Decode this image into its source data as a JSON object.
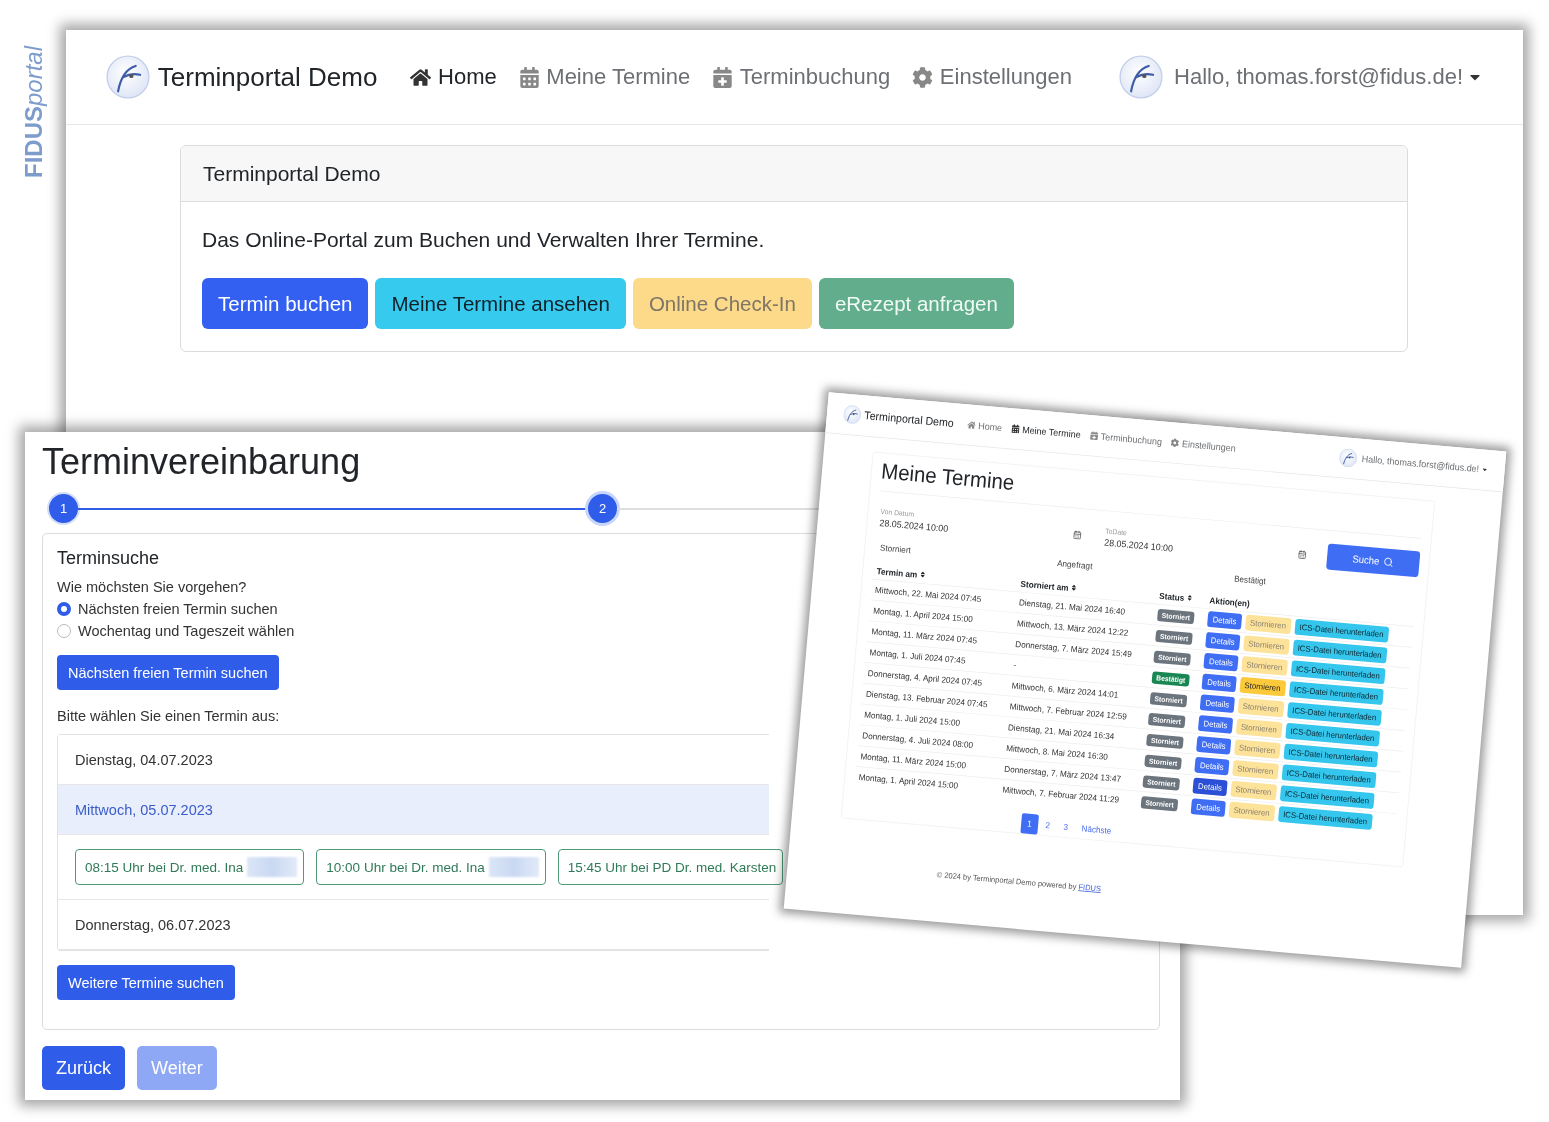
{
  "brand_label": {
    "bold_part": "FIDUS",
    "italic_part": "portal"
  },
  "portal_window": {
    "navbar": {
      "title": "Terminportal Demo",
      "nav": [
        {
          "kind": "home",
          "label": "Home",
          "selected": true
        },
        {
          "kind": "appointments",
          "label": "Meine Termine",
          "selected": false
        },
        {
          "kind": "booking",
          "label": "Terminbuchung",
          "selected": false
        },
        {
          "kind": "settings",
          "label": "Einstellungen",
          "selected": false
        }
      ],
      "greeting": "Hallo, thomas.forst@fidus.de!"
    },
    "card": {
      "title": "Terminportal Demo",
      "text": "Das Online-Portal zum Buchen und Verwalten Ihrer Termine.",
      "buttons": [
        "Termin buchen",
        "Meine Termine ansehen",
        "Online Check-In",
        "eRezept anfragen"
      ]
    }
  },
  "booking_window": {
    "title": "Terminvereinbarung",
    "steps": [
      {
        "label": "1",
        "selected": false
      },
      {
        "label": "2",
        "selected": true
      }
    ],
    "search": {
      "title": "Terminsuche",
      "question": "Wie möchsten Sie vorgehen?",
      "options": [
        {
          "label": "Nächsten freien Termin suchen",
          "selected": true
        },
        {
          "label": "Wochentag und Tageszeit wählen",
          "selected": false
        }
      ],
      "search_button": "Nächsten freien Termin suchen",
      "prompt": "Bitte wählen Sie einen Termin aus:",
      "days": [
        {
          "label": "Dienstag, 04.07.2023",
          "selected": false
        },
        {
          "label": "Mittwoch, 05.07.2023",
          "selected": true,
          "slots": [
            {
              "label": "08:15 Uhr bei Dr. med. Ina",
              "masked": true
            },
            {
              "label": "10:00 Uhr bei Dr. med. Ina",
              "masked": true
            },
            {
              "label": "15:45 Uhr bei PD Dr. med. Karsten",
              "masked": false
            }
          ]
        },
        {
          "label": "Donnerstag, 06.07.2023",
          "selected": false
        }
      ],
      "more_button": "Weitere Termine suchen"
    },
    "back_button": {
      "label": "Zurück",
      "disabled": false
    },
    "next_button": {
      "label": "Weiter",
      "disabled": true
    }
  },
  "appointments_window": {
    "navbar": {
      "title": "Terminportal Demo",
      "nav": [
        {
          "kind": "home",
          "label": "Home",
          "selected": false
        },
        {
          "kind": "appointments",
          "label": "Meine Termine",
          "selected": true
        },
        {
          "kind": "booking",
          "label": "Terminbuchung",
          "selected": false
        },
        {
          "kind": "settings",
          "label": "Einstellungen",
          "selected": false
        }
      ],
      "greeting": "Hallo, thomas.forst@fidus.de!"
    },
    "title": "Meine Termine",
    "from_field": {
      "label": "Von Datum",
      "value": "28.05.2024 10:00"
    },
    "to_field": {
      "label": "ToDate",
      "value": "28.05.2024 10:00"
    },
    "search_button": "Suche",
    "filters": [
      "Storniert",
      "Angefragt",
      "Bestätigt"
    ],
    "columns": [
      "Termin am",
      "Storniert am",
      "Status",
      "Aktion(en)"
    ],
    "rows": [
      {
        "date": "Mittwoch, 22. Mai 2024 07:45",
        "cancelled": "Dienstag, 21. Mai 2024 16:40",
        "status": "Storniert",
        "color": "#6c757d",
        "details": "Details",
        "cancel": "Stornieren",
        "download": "ICS-Datei herunterladen",
        "cancel_disabled": true,
        "details_hovered": false
      },
      {
        "date": "Montag, 1. April 2024 15:00",
        "cancelled": "Mittwoch, 13. März 2024 12:22",
        "status": "Storniert",
        "color": "#6c757d",
        "details": "Details",
        "cancel": "Stornieren",
        "download": "ICS-Datei herunterladen",
        "cancel_disabled": true,
        "details_hovered": false
      },
      {
        "date": "Montag, 11. März 2024 07:45",
        "cancelled": "Donnerstag, 7. März 2024 15:49",
        "status": "Storniert",
        "color": "#6c757d",
        "details": "Details",
        "cancel": "Stornieren",
        "download": "ICS-Datei herunterladen",
        "cancel_disabled": true,
        "details_hovered": false
      },
      {
        "date": "Montag, 1. Juli 2024 07:45",
        "cancelled": "-",
        "status": "Bestätigt",
        "color": "#198754",
        "details": "Details",
        "cancel": "Stornieren",
        "download": "ICS-Datei herunterladen",
        "cancel_disabled": false,
        "details_hovered": false
      },
      {
        "date": "Donnerstag, 4. April 2024 07:45",
        "cancelled": "Mittwoch, 6. März 2024 14:01",
        "status": "Storniert",
        "color": "#6c757d",
        "details": "Details",
        "cancel": "Stornieren",
        "download": "ICS-Datei herunterladen",
        "cancel_disabled": true,
        "details_hovered": false
      },
      {
        "date": "Dienstag, 13. Februar 2024 07:45",
        "cancelled": "Mittwoch, 7. Februar 2024 12:59",
        "status": "Storniert",
        "color": "#6c757d",
        "details": "Details",
        "cancel": "Stornieren",
        "download": "ICS-Datei herunterladen",
        "cancel_disabled": true,
        "details_hovered": false
      },
      {
        "date": "Montag, 1. Juli 2024 15:00",
        "cancelled": "Dienstag, 21. Mai 2024 16:34",
        "status": "Storniert",
        "color": "#6c757d",
        "details": "Details",
        "cancel": "Stornieren",
        "download": "ICS-Datei herunterladen",
        "cancel_disabled": true,
        "details_hovered": false
      },
      {
        "date": "Donnerstag, 4. Juli 2024 08:00",
        "cancelled": "Mittwoch, 8. Mai 2024 16:30",
        "status": "Storniert",
        "color": "#6c757d",
        "details": "Details",
        "cancel": "Stornieren",
        "download": "ICS-Datei herunterladen",
        "cancel_disabled": true,
        "details_hovered": false
      },
      {
        "date": "Montag, 11. März 2024 15:00",
        "cancelled": "Donnerstag, 7. März 2024 13:47",
        "status": "Storniert",
        "color": "#6c757d",
        "details": "Details",
        "cancel": "Stornieren",
        "download": "ICS-Datei herunterladen",
        "cancel_disabled": true,
        "details_hovered": true
      },
      {
        "date": "Montag, 1. April 2024 15:00",
        "cancelled": "Mittwoch, 7. Februar 2024 11:29",
        "status": "Storniert",
        "color": "#6c757d",
        "details": "Details",
        "cancel": "Stornieren",
        "download": "ICS-Datei herunterladen",
        "cancel_disabled": true,
        "details_hovered": false
      }
    ],
    "pages": [
      {
        "label": "1",
        "selected": true
      },
      {
        "label": "2",
        "selected": false
      },
      {
        "label": "3",
        "selected": false
      }
    ],
    "next_page": "Nächste",
    "footer": {
      "text": "© 2024 by Terminportal Demo powered by",
      "link": "FIDUS"
    }
  }
}
